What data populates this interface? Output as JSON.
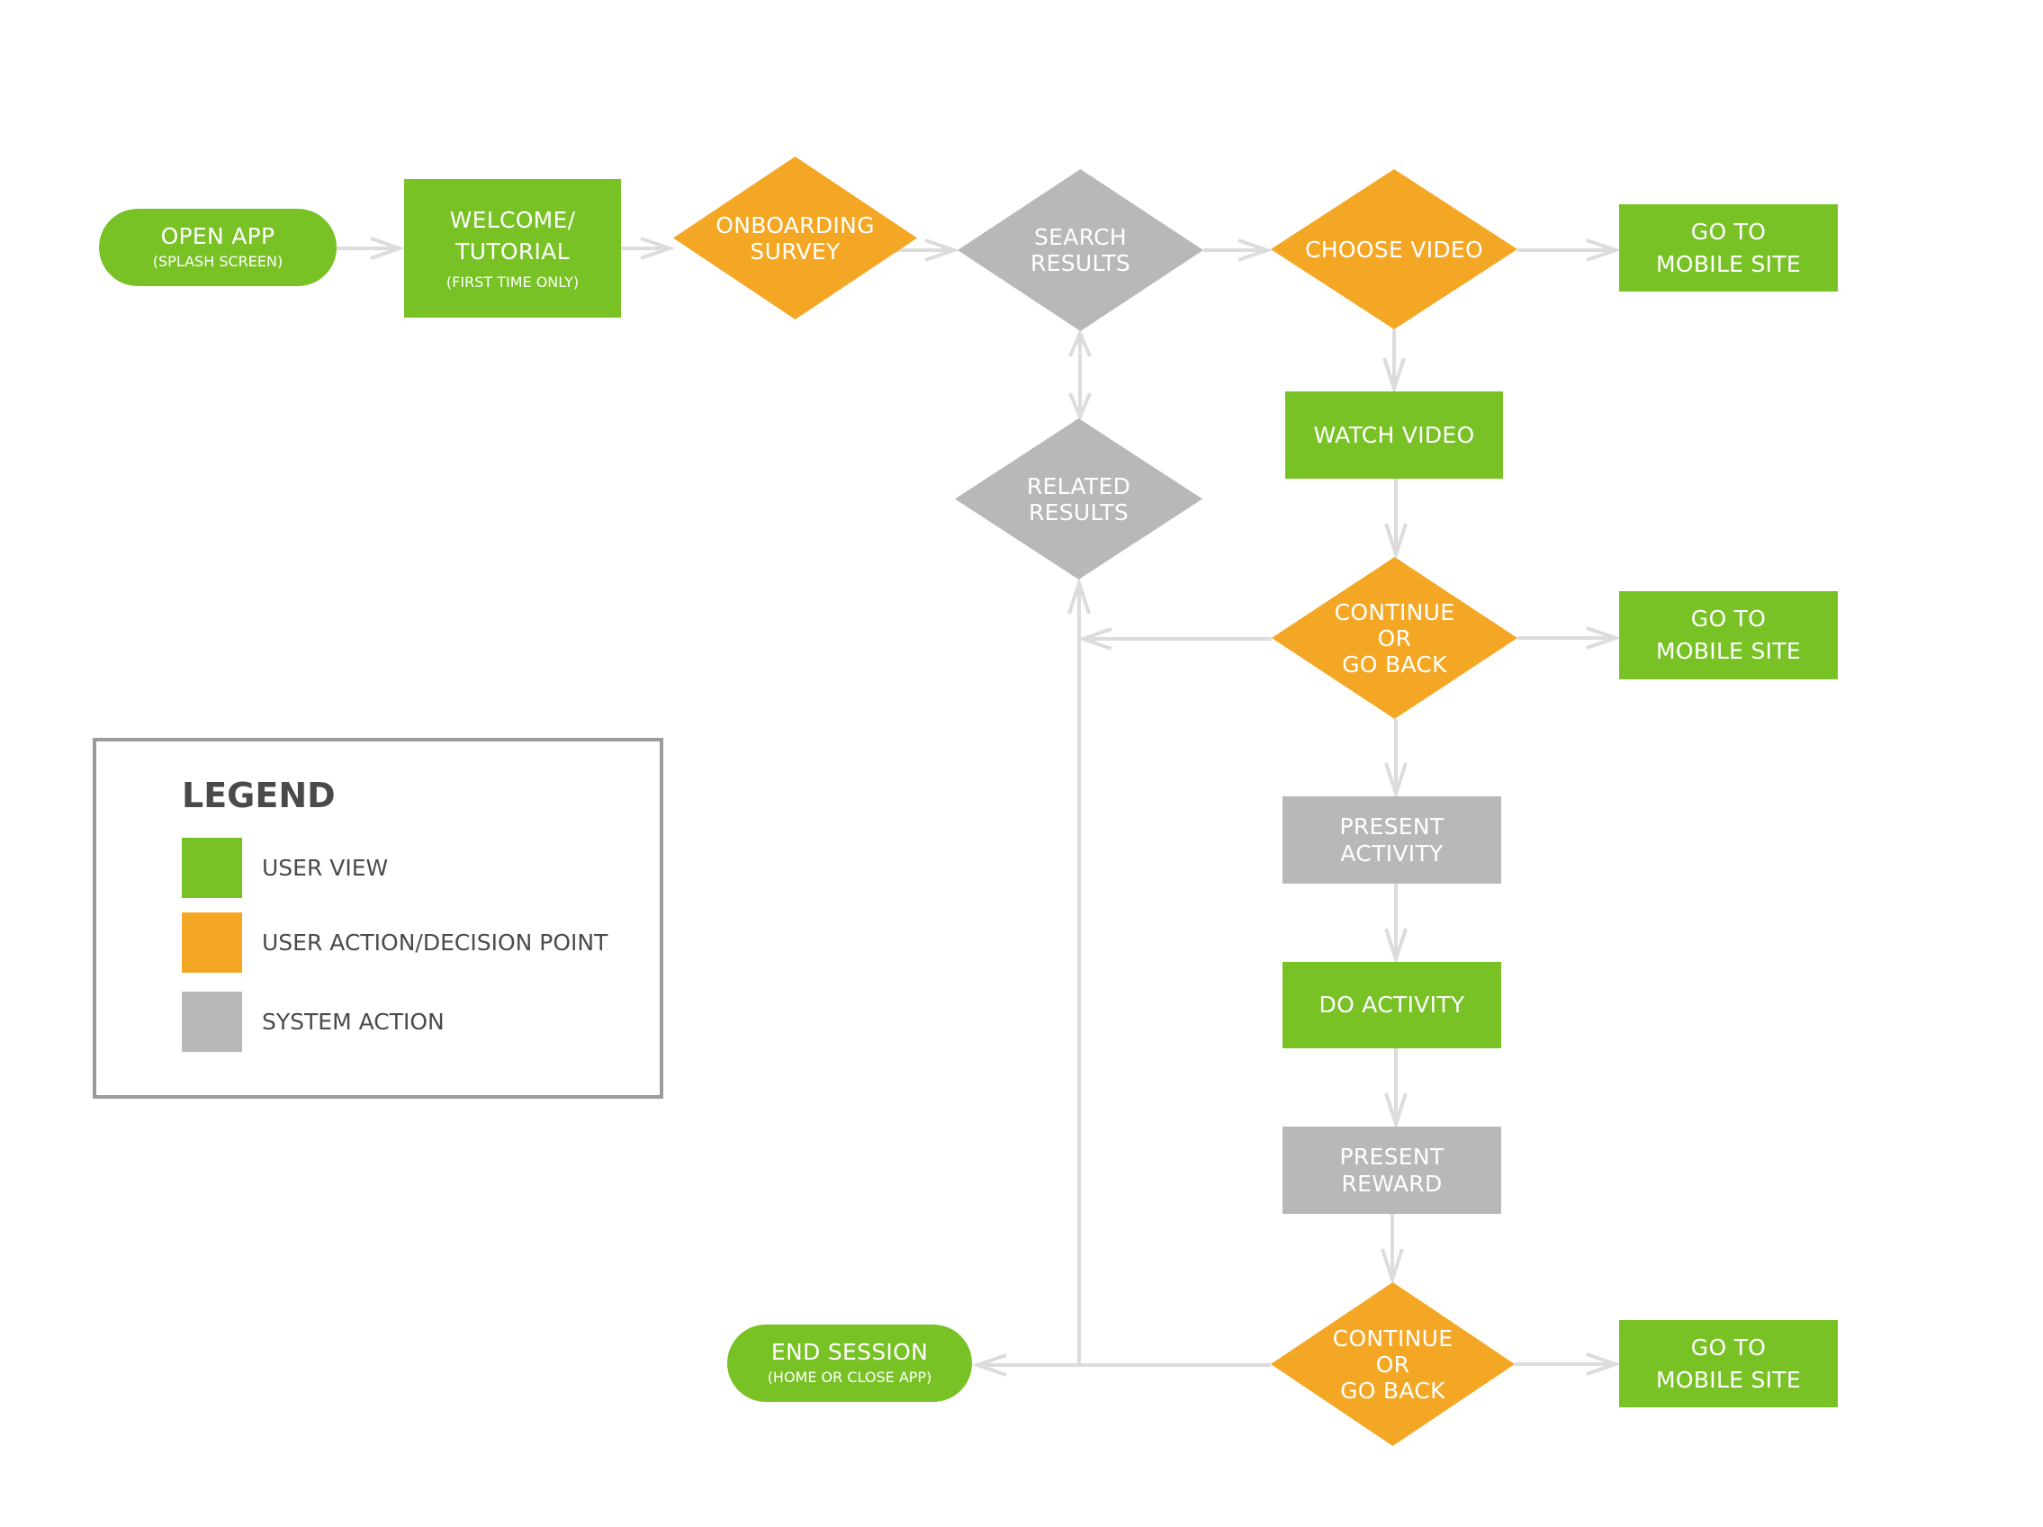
{
  "colors": {
    "user_view": "#78c225",
    "user_action": "#f4a724",
    "system_action": "#b8b8b8",
    "connector": "#dcdcdc",
    "legend_border": "#9b9b9b",
    "legend_text": "#4a4a4a"
  },
  "nodes": {
    "open_app": {
      "label": "OPEN APP",
      "sub": "(SPLASH SCREEN)"
    },
    "welcome": {
      "label1": "WELCOME/",
      "label2": "TUTORIAL",
      "sub": "(FIRST TIME ONLY)"
    },
    "onboarding": {
      "label1": "ONBOARDING",
      "label2": "SURVEY"
    },
    "search_results": {
      "label1": "SEARCH",
      "label2": "RESULTS"
    },
    "choose_video": {
      "label": "CHOOSE VIDEO"
    },
    "mobile_site_1": {
      "label1": "GO TO",
      "label2": "MOBILE SITE"
    },
    "watch_video": {
      "label": "WATCH VIDEO"
    },
    "related_results": {
      "label1": "RELATED",
      "label2": "RESULTS"
    },
    "continue_1": {
      "label1": "CONTINUE",
      "label2": "OR",
      "label3": "GO BACK"
    },
    "mobile_site_2": {
      "label1": "GO TO",
      "label2": "MOBILE SITE"
    },
    "present_activity": {
      "label1": "PRESENT",
      "label2": "ACTIVITY"
    },
    "do_activity": {
      "label": "DO ACTIVITY"
    },
    "present_reward": {
      "label1": "PRESENT",
      "label2": "REWARD"
    },
    "continue_2": {
      "label1": "CONTINUE",
      "label2": "OR",
      "label3": "GO BACK"
    },
    "mobile_site_3": {
      "label1": "GO TO",
      "label2": "MOBILE SITE"
    },
    "end_session": {
      "label": "END SESSION",
      "sub": "(HOME OR CLOSE APP)"
    }
  },
  "legend": {
    "title": "LEGEND",
    "items": [
      {
        "label": "USER VIEW",
        "type": "user_view"
      },
      {
        "label": "USER ACTION/DECISION POINT",
        "type": "user_action"
      },
      {
        "label": "SYSTEM ACTION",
        "type": "system_action"
      }
    ]
  },
  "edges": [
    {
      "from": "open_app",
      "to": "welcome"
    },
    {
      "from": "welcome",
      "to": "onboarding"
    },
    {
      "from": "onboarding",
      "to": "search_results"
    },
    {
      "from": "search_results",
      "to": "choose_video"
    },
    {
      "from": "choose_video",
      "to": "mobile_site_1"
    },
    {
      "from": "choose_video",
      "to": "watch_video"
    },
    {
      "from": "search_results",
      "to": "related_results",
      "bidirectional": true
    },
    {
      "from": "watch_video",
      "to": "continue_1"
    },
    {
      "from": "continue_1",
      "to": "related_results"
    },
    {
      "from": "continue_1",
      "to": "mobile_site_2"
    },
    {
      "from": "continue_1",
      "to": "present_activity"
    },
    {
      "from": "present_activity",
      "to": "do_activity"
    },
    {
      "from": "do_activity",
      "to": "present_reward"
    },
    {
      "from": "present_reward",
      "to": "continue_2"
    },
    {
      "from": "continue_2",
      "to": "mobile_site_3"
    },
    {
      "from": "continue_2",
      "to": "end_session"
    },
    {
      "from": "continue_2",
      "to": "related_results"
    }
  ]
}
